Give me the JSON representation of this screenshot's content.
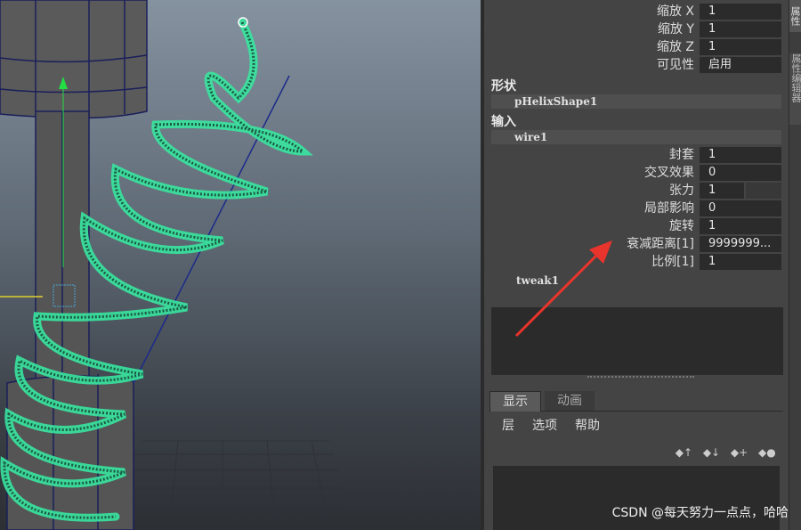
{
  "attributes": {
    "scale_x": {
      "label": "缩放 X",
      "value": "1"
    },
    "scale_y": {
      "label": "缩放 Y",
      "value": "1"
    },
    "scale_z": {
      "label": "缩放 Z",
      "value": "1"
    },
    "visibility": {
      "label": "可见性",
      "value": "启用"
    }
  },
  "shape_section": {
    "title": "形状",
    "node": "pHelixShape1"
  },
  "input_section": {
    "title": "输入",
    "node": "wire1"
  },
  "wire_attrs": {
    "envelope": {
      "label": "封套",
      "value": "1"
    },
    "crossing_effect": {
      "label": "交叉效果",
      "value": "0"
    },
    "tension": {
      "label": "张力",
      "value": "1"
    },
    "local_influence": {
      "label": "局部影响",
      "value": "0"
    },
    "rotation": {
      "label": "旋转",
      "value": "1"
    },
    "dropoff_distance": {
      "label": "衰减距离[1]",
      "value": "9999999..."
    },
    "scale": {
      "label": "比例[1]",
      "value": "1"
    }
  },
  "tweak_node": "tweak1",
  "layer_editor": {
    "tabs": [
      "显示",
      "动画"
    ],
    "menu": [
      "层",
      "选项",
      "帮助"
    ]
  },
  "side_tabs": [
    "属性",
    "属性编辑器"
  ],
  "watermark": "CSDN @每天努力一点点，哈哈",
  "colors": {
    "wire": "#39e6a0",
    "arrow": "#e8342c"
  }
}
